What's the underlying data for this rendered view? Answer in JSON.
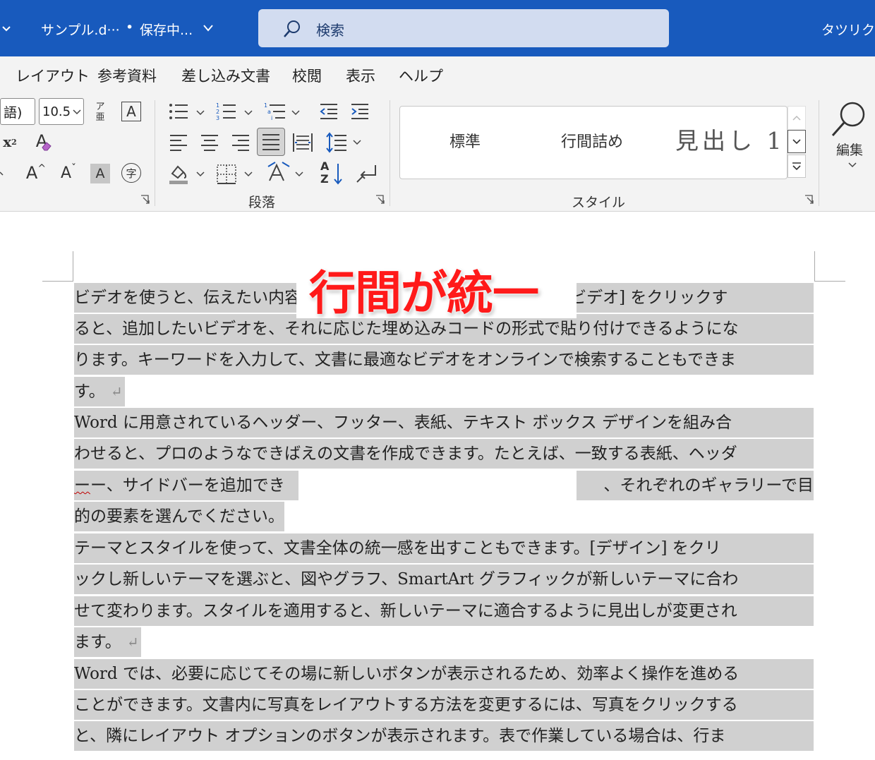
{
  "titlebar": {
    "doc_name": "サンプル.d···",
    "status_dot": "•",
    "status": "保存中...",
    "user": "タツリク エ",
    "search_placeholder": "検索",
    "bg_color": "#185abd"
  },
  "tabs": [
    "レイアウト",
    "参考資料",
    "差し込み文書",
    "校閲",
    "表示",
    "ヘルプ"
  ],
  "ribbon": {
    "font": {
      "font_name_partial": "語)",
      "font_size_partial": "10.5",
      "phonetic_top": "ア",
      "phonetic_bottom": "亜",
      "char_border": "A",
      "superscript_base": "x",
      "superscript_exp": "2",
      "clear_format": "A",
      "grow_font": "A",
      "grow_caret": "^",
      "shrink_font": "A",
      "shrink_caret": "ˇ",
      "char_shading": "A",
      "enclose_char": "字"
    },
    "paragraph_label": "段落",
    "sort_top": "A",
    "sort_bottom": "Z",
    "styles_label": "スタイル",
    "styles": {
      "normal": "標準",
      "no_spacing": "行間詰め",
      "heading1": "見出し 1"
    },
    "edit_label": "編集"
  },
  "document": {
    "paragraphs": [
      {
        "lines": [
          "ビデオを使うと、伝えたい内容を明確に表現できます。[オンライン ビデオ] をクリックす",
          "ると、追加したいビデオを、それに応じた埋め込みコードの形式で貼り付けできるようにな",
          "ります。キーワードを入力して、文書に最適なビデオをオンラインで検索することもできま",
          "す。"
        ]
      },
      {
        "lines": [
          "Word に用意されているヘッダー、フッター、表紙、テキスト ボックス デザインを組み合",
          "わせると、プロのようなできばえの文書を作成できます。たとえば、一致する表紙、ヘッダ"
        ],
        "line3_start": "ー、サイドバーを追加でき",
        "line3_end": "、それぞれのギャラリーで目",
        "line4": "的の要素を選んでください。"
      },
      {
        "lines": [
          "テーマとスタイルを使って、文書全体の統一感を出すこともできます。[デザイン] をクリ",
          "ックし新しいテーマを選ぶと、図やグラフ、SmartArt グラフィックが新しいテーマに合わ",
          "せて変わります。スタイルを適用すると、新しいテーマに適合するように見出しが変更され",
          "ます。"
        ]
      },
      {
        "lines": [
          "Word では、必要に応じてその場に新しいボタンが表示されるため、効率よく操作を進める",
          "ことができます。文書内に写真をレイアウトする方法を変更するには、写真をクリックする",
          "と、隣にレイアウト オプションのボタンが表示されます。表で作業している場合は、行ま"
        ]
      }
    ],
    "paragraph_mark": "↵",
    "highlight_color": "#d0d0d0"
  },
  "annotation": {
    "text": "行間が統一",
    "color": "#ff1a1a"
  }
}
